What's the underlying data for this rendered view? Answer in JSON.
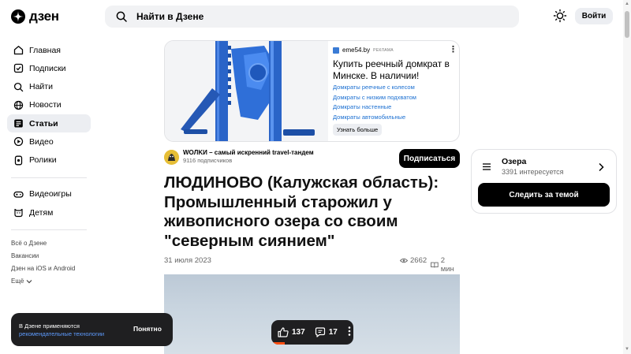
{
  "header": {
    "logo_text": "дзен",
    "search_placeholder": "Найти в Дзене",
    "login_label": "Войти"
  },
  "sidebar": {
    "items": [
      {
        "label": "Главная",
        "icon": "home-icon"
      },
      {
        "label": "Подписки",
        "icon": "subscriptions-icon"
      },
      {
        "label": "Найти",
        "icon": "search-icon"
      },
      {
        "label": "Новости",
        "icon": "news-icon"
      },
      {
        "label": "Статьи",
        "icon": "articles-icon",
        "active": true
      },
      {
        "label": "Видео",
        "icon": "video-icon"
      },
      {
        "label": "Ролики",
        "icon": "shorts-icon"
      },
      {
        "label": "Видеоигры",
        "icon": "gamepad-icon"
      },
      {
        "label": "Детям",
        "icon": "kids-icon"
      }
    ],
    "footer": [
      "Всё о Дзене",
      "Вакансии",
      "Дзен на iOS и Android"
    ],
    "more_label": "Ещё"
  },
  "ad": {
    "domain": "eme54.by",
    "tag": "РЕКЛАМА",
    "title": "Купить реечный домкрат в Минске. В наличии!",
    "links": [
      "Домкраты реечные с колесом",
      "Домкраты с низким подхватом",
      "Домкраты настенные",
      "Домкраты автомобильные"
    ],
    "more_label": "Узнать больше"
  },
  "channel": {
    "name": "WOЛKИ – самый искренний travel-тандем",
    "subscribers": "9116 подписчиков",
    "subscribe_label": "Подписаться"
  },
  "article": {
    "title": "ЛЮДИНОВО (Калужская область): Промышленный старожил у живописного озера со своим \"северным сиянием\"",
    "date": "31 июля 2023",
    "views": "2662",
    "read_time": "2 мин"
  },
  "topic": {
    "name": "Озера",
    "interested": "3391 интересуется",
    "follow_label": "Следить за темой"
  },
  "cookie": {
    "text": "В Дзене применяются",
    "link_text": "рекомендательные технологии",
    "ok_label": "Понятно"
  },
  "reactions": {
    "likes": "137",
    "comments": "17",
    "read_progress": 0.16
  },
  "colors": {
    "accent_progress": "#ff4f12",
    "link": "#1b6fd1",
    "dark": "#1f1f21"
  }
}
